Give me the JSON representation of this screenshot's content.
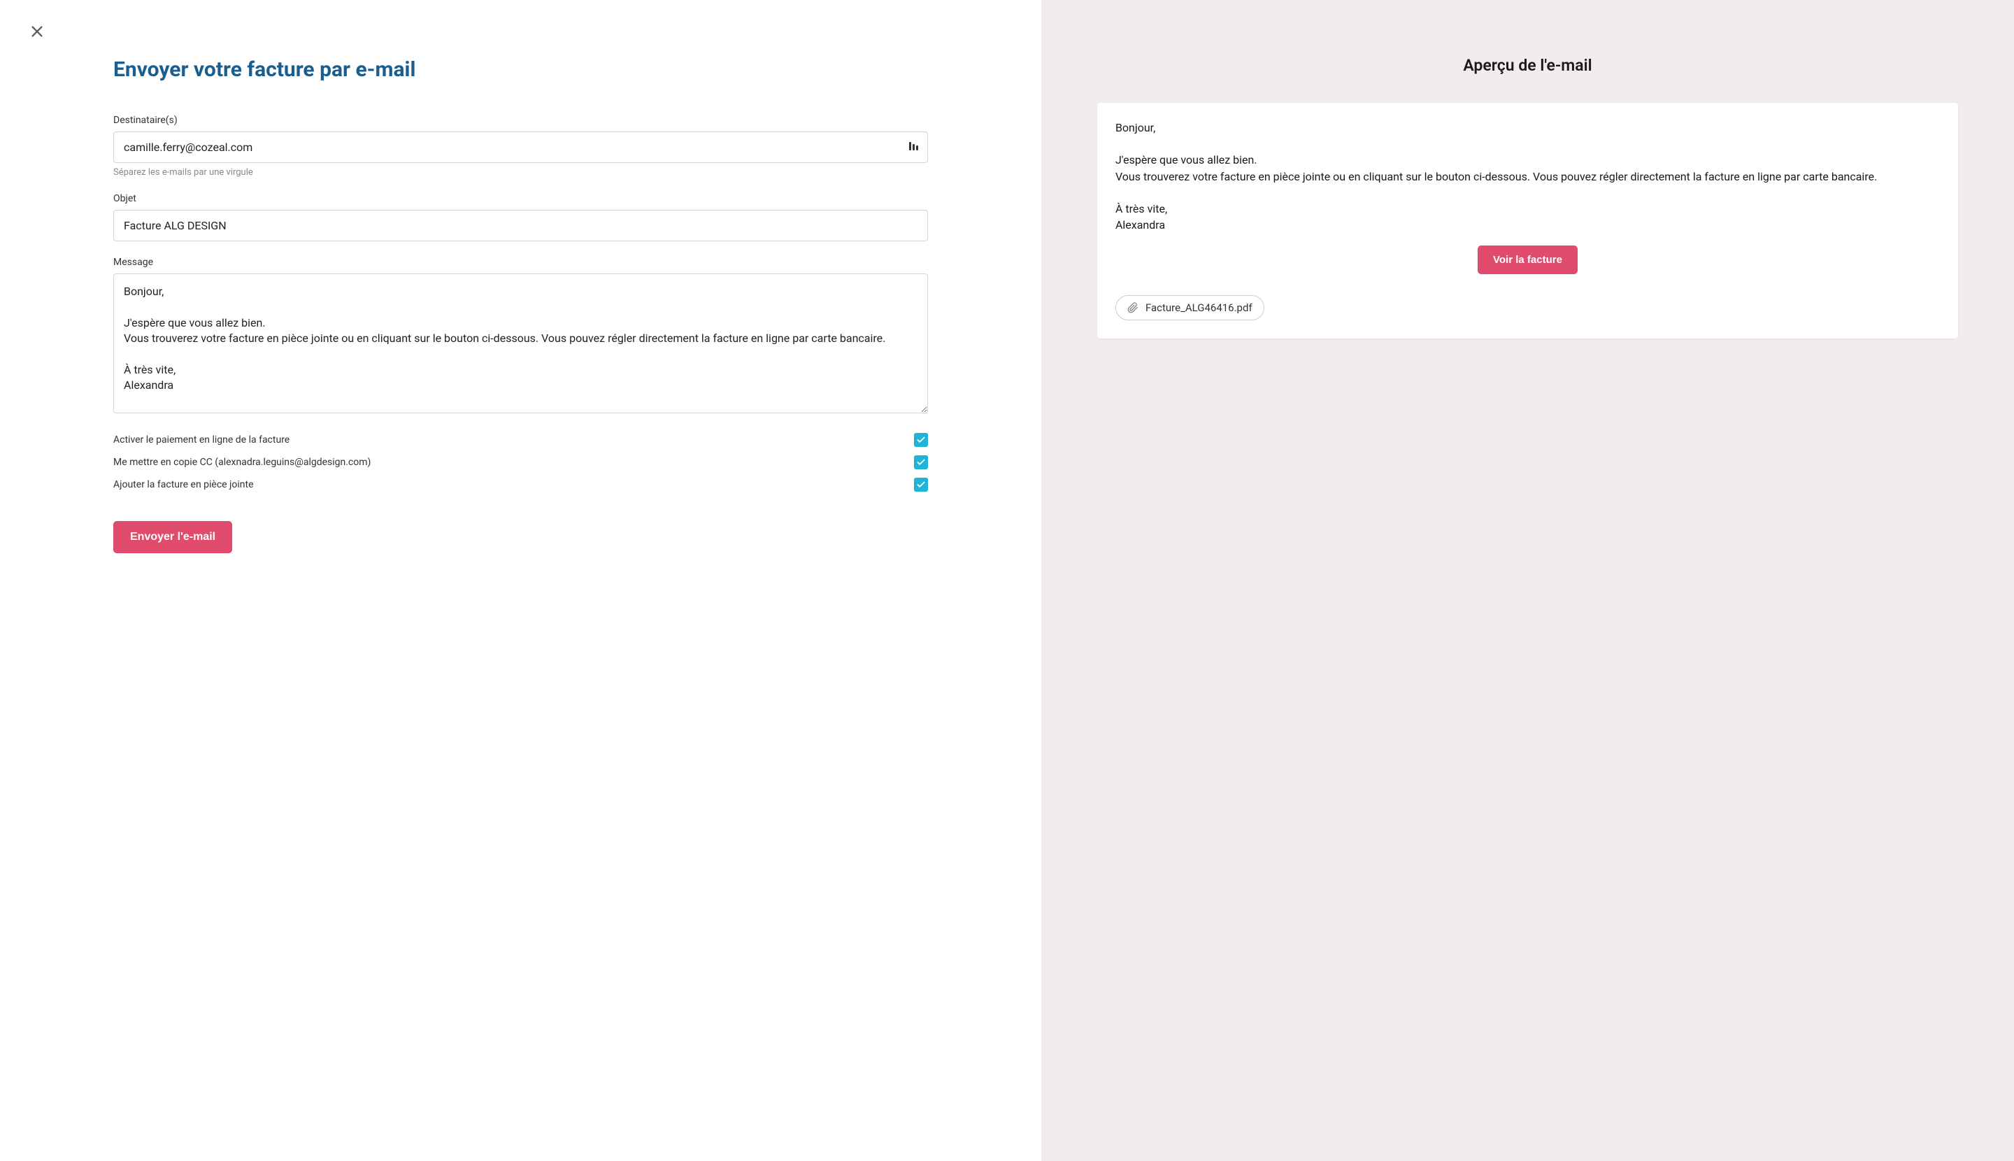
{
  "form": {
    "title": "Envoyer votre facture par e-mail",
    "recipients": {
      "label": "Destinataire(s)",
      "value": "camille.ferry@cozeal.com",
      "help": "Séparez les e-mails par une virgule"
    },
    "subject": {
      "label": "Objet",
      "value": "Facture ALG DESIGN"
    },
    "message": {
      "label": "Message",
      "value": "Bonjour,\n\nJ'espère que vous allez bien.\nVous trouverez votre facture en pièce jointe ou en cliquant sur le bouton ci-dessous. Vous pouvez régler directement la facture en ligne par carte bancaire.\n\nÀ très vite,\nAlexandra"
    },
    "options": {
      "online_payment": {
        "label": "Activer le paiement en ligne de la facture",
        "checked": true
      },
      "cc_me": {
        "label": "Me mettre en copie CC (alexnadra.leguins@algdesign.com)",
        "checked": true
      },
      "attach_invoice": {
        "label": "Ajouter la facture en pièce jointe",
        "checked": true
      }
    },
    "send_button": "Envoyer l'e-mail"
  },
  "preview": {
    "title": "Aperçu de l'e-mail",
    "body": "Bonjour,\n\nJ'espère que vous allez bien.\nVous trouverez votre facture en pièce jointe ou en cliquant sur le bouton ci-dessous. Vous pouvez régler directement la facture en ligne par carte bancaire.\n\nÀ très vite,\nAlexandra",
    "view_button": "Voir la facture",
    "attachment": "Facture_ALG46416.pdf"
  }
}
